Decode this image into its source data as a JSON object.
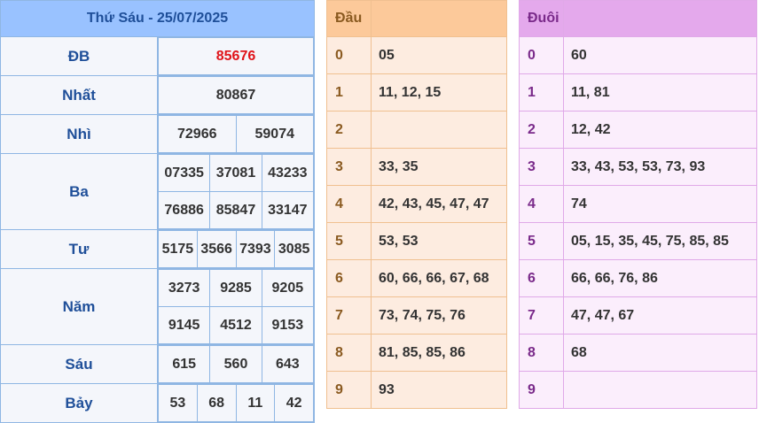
{
  "results": {
    "title": "Thứ Sáu - 25/07/2025",
    "rows": [
      {
        "label": "ĐB",
        "lines": [
          [
            "85676"
          ]
        ]
      },
      {
        "label": "Nhất",
        "lines": [
          [
            "80867"
          ]
        ]
      },
      {
        "label": "Nhì",
        "lines": [
          [
            "72966",
            "59074"
          ]
        ]
      },
      {
        "label": "Ba",
        "lines": [
          [
            "07335",
            "37081",
            "43233"
          ],
          [
            "76886",
            "85847",
            "33147"
          ]
        ]
      },
      {
        "label": "Tư",
        "lines": [
          [
            "5175",
            "3566",
            "7393",
            "3085"
          ]
        ]
      },
      {
        "label": "Năm",
        "lines": [
          [
            "3273",
            "9285",
            "9205"
          ],
          [
            "9145",
            "4512",
            "9153"
          ]
        ]
      },
      {
        "label": "Sáu",
        "lines": [
          [
            "615",
            "560",
            "643"
          ]
        ]
      },
      {
        "label": "Bảy",
        "lines": [
          [
            "53",
            "68",
            "11",
            "42"
          ]
        ]
      }
    ]
  },
  "dau": {
    "header": "Đầu",
    "rows": [
      {
        "key": "0",
        "value": "05"
      },
      {
        "key": "1",
        "value": "11, 12, 15"
      },
      {
        "key": "2",
        "value": ""
      },
      {
        "key": "3",
        "value": "33, 35"
      },
      {
        "key": "4",
        "value": "42, 43, 45, 47, 47"
      },
      {
        "key": "5",
        "value": "53, 53"
      },
      {
        "key": "6",
        "value": "60, 66, 66, 67, 68"
      },
      {
        "key": "7",
        "value": "73, 74, 75, 76"
      },
      {
        "key": "8",
        "value": "81, 85, 85, 86"
      },
      {
        "key": "9",
        "value": "93"
      }
    ]
  },
  "duoi": {
    "header": "Đuôi",
    "rows": [
      {
        "key": "0",
        "value": "60"
      },
      {
        "key": "1",
        "value": "11, 81"
      },
      {
        "key": "2",
        "value": "12, 42"
      },
      {
        "key": "3",
        "value": "33, 43, 53, 53, 73, 93"
      },
      {
        "key": "4",
        "value": "74"
      },
      {
        "key": "5",
        "value": "05, 15, 35, 45, 75, 85, 85"
      },
      {
        "key": "6",
        "value": "66, 66, 76, 86"
      },
      {
        "key": "7",
        "value": "47, 47, 67"
      },
      {
        "key": "8",
        "value": "68"
      },
      {
        "key": "9",
        "value": ""
      }
    ]
  },
  "colors": {
    "special_prize": "#e0141a",
    "label_blue": "#1f4f99",
    "dau_header": "#fcc99a",
    "duoi_header": "#e4a9ec"
  }
}
